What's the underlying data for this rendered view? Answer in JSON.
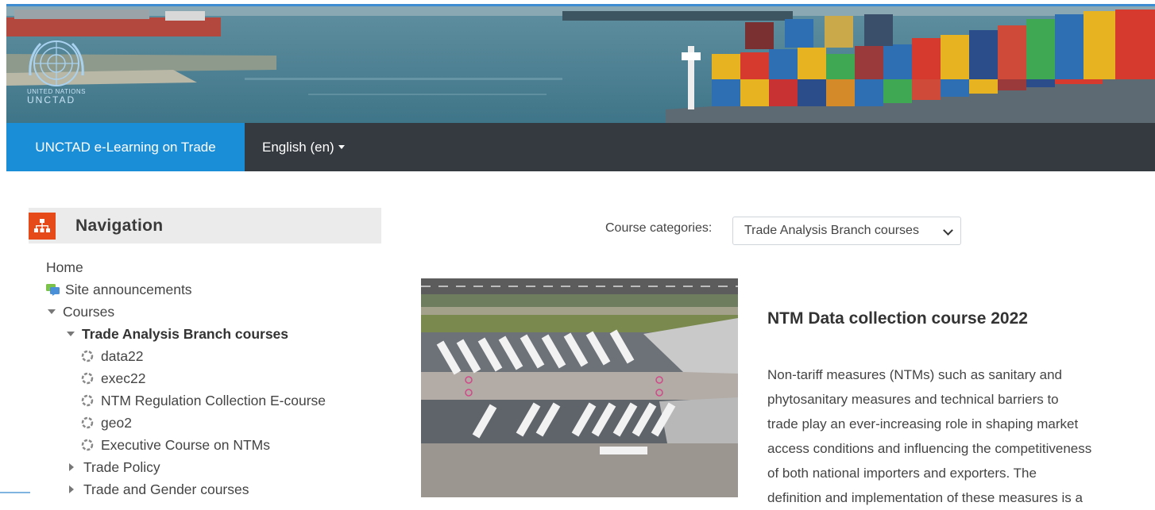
{
  "logo": {
    "line1": "UNITED NATIONS",
    "line2": "UNCTAD"
  },
  "navbar": {
    "brand": "UNCTAD e-Learning on Trade",
    "language": "English (en)"
  },
  "navigation": {
    "title": "Navigation",
    "home": "Home",
    "site_announcements": "Site announcements",
    "courses": "Courses",
    "category": "Trade Analysis Branch courses",
    "course_items": [
      "data22",
      "exec22",
      "NTM Regulation Collection E-course",
      "geo2",
      "Executive Course on NTMs"
    ],
    "collapsed_categories": [
      "Trade Policy",
      "Trade and Gender courses"
    ]
  },
  "course_categories": {
    "label": "Course categories:",
    "selected": "Trade Analysis Branch courses"
  },
  "course": {
    "title": "NTM Data collection course 2022",
    "description_lines": [
      "Non-tariff measures (NTMs) such as sanitary and",
      "phytosanitary measures and technical barriers to",
      "trade play an ever-increasing role in shaping market",
      "access conditions and influencing the competitiveness",
      "of both national importers and exporters. The",
      "definition and implementation of these measures is a"
    ]
  },
  "colors": {
    "brand_blue": "#1b8ed8",
    "navbar_dark": "#343a40",
    "nav_icon": "#e64a19"
  }
}
